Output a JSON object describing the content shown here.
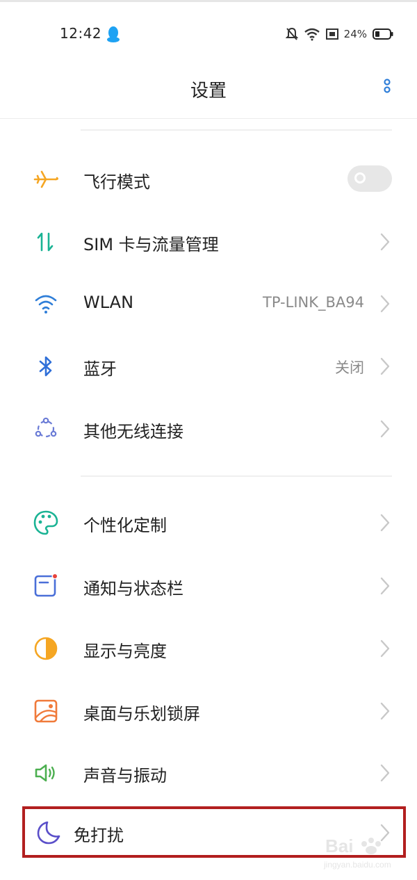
{
  "status_bar": {
    "time": "12:42",
    "battery": "24%",
    "icons": [
      "qq-icon",
      "bell-muted-icon",
      "wifi-icon",
      "sim-icon",
      "battery-icon"
    ]
  },
  "header": {
    "title": "设置",
    "menu_icon": "more-vertical-icon"
  },
  "settings": [
    {
      "label": "飞行模式",
      "icon": "airplane-icon",
      "control": "toggle",
      "toggle_on": false
    },
    {
      "label": "SIM 卡与流量管理",
      "icon": "sim-data-icon"
    },
    {
      "label": "WLAN",
      "icon": "wifi-icon",
      "value": "TP-LINK_BA94"
    },
    {
      "label": "蓝牙",
      "icon": "bluetooth-icon",
      "value": "关闭"
    },
    {
      "label": "其他无线连接",
      "icon": "wireless-connections-icon"
    },
    {
      "label": "个性化定制",
      "icon": "palette-icon"
    },
    {
      "label": "通知与状态栏",
      "icon": "notification-icon"
    },
    {
      "label": "显示与亮度",
      "icon": "brightness-icon"
    },
    {
      "label": "桌面与乐划锁屏",
      "icon": "wallpaper-icon"
    },
    {
      "label": "声音与振动",
      "icon": "speaker-icon"
    },
    {
      "label": "免打扰",
      "icon": "moon-icon"
    }
  ],
  "watermark": {
    "brand": "Bai",
    "domain": "jingyan.baidu.com"
  },
  "colors": {
    "highlight": "#b21f1f",
    "toggle_off": "#e7e7e7",
    "accent_blue": "#2f7ed8"
  }
}
